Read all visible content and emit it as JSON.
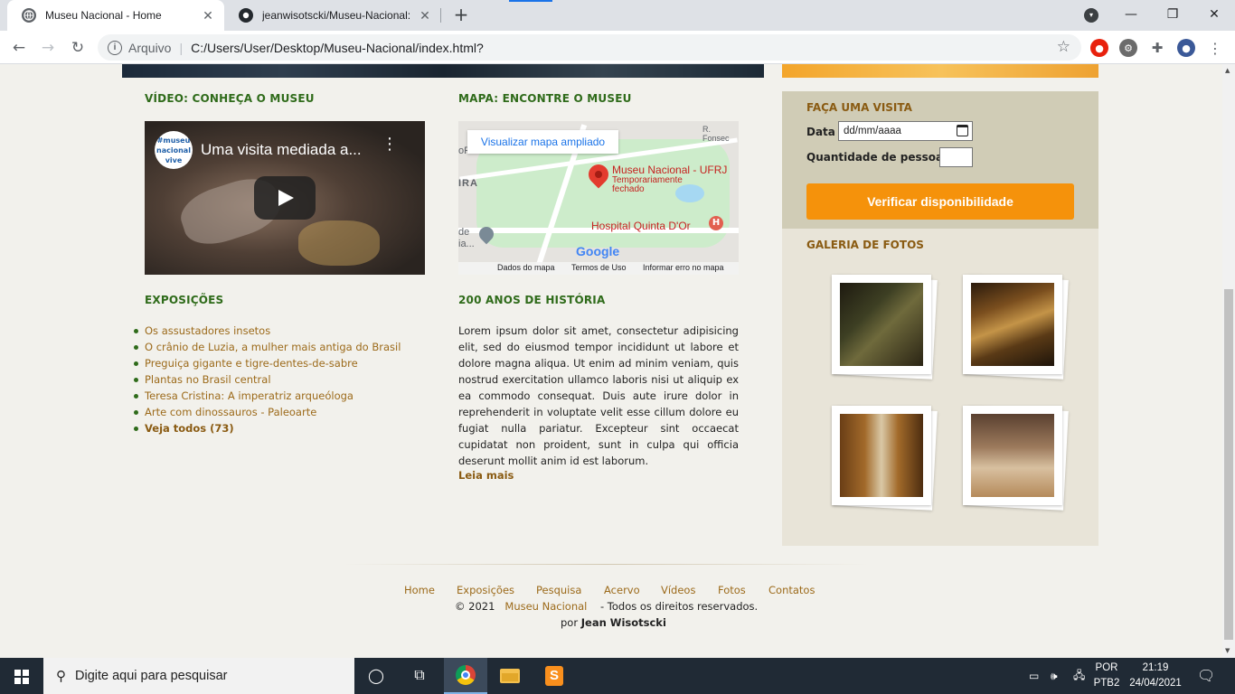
{
  "browser": {
    "tabs": [
      {
        "title": "Museu Nacional - Home",
        "active": true
      },
      {
        "title": "jeanwisotscki/Museu-Nacional: P",
        "active": false
      }
    ],
    "address": {
      "scheme_label": "Arquivo",
      "url": "C:/Users/User/Desktop/Museu-Nacional/index.html?"
    }
  },
  "sections": {
    "video_title": "VÍDEO: CONHEÇA O MUSEU",
    "map_title": "MAPA: ENCONTRE O MUSEU",
    "expos_title": "EXPOSIÇÕES",
    "history_title": "200 ANOS DE HISTÓRIA"
  },
  "video": {
    "channel_logo": "#museu nacional vive",
    "title": "Uma visita mediada a..."
  },
  "map": {
    "enlarge_button": "Visualizar mapa ampliado",
    "place_name": "Museu Nacional - UFRJ",
    "place_status": "Temporariamente fechado",
    "hospital": "Hospital Quinta D'Or",
    "hospital_icon": "H",
    "edge_label_1": "R. Fonsec",
    "edge_label_2": "IRA",
    "edge_label_3": "de",
    "edge_label_4": "ia...",
    "edge_label_5": "oF",
    "google_logo": "Google",
    "footer": [
      "Dados do mapa",
      "Termos de Uso",
      "Informar erro no mapa"
    ]
  },
  "exposicoes": {
    "items": [
      "Os assustadores insetos",
      "O crânio de Luzia, a mulher mais antiga do Brasil",
      "Preguiça gigante e tigre-dentes-de-sabre",
      "Plantas no Brasil central",
      "Teresa Cristina: A imperatriz arqueóloga",
      "Arte com dinossauros - Paleoarte"
    ],
    "see_all": "Veja todos (73)"
  },
  "historia": {
    "text": "Lorem ipsum dolor sit amet, consectetur adipisicing elit, sed do eiusmod tempor incididunt ut labore et dolore magna aliqua. Ut enim ad minim veniam, quis nostrud exercitation ullamco laboris nisi ut aliquip ex ea commodo consequat. Duis aute irure dolor in reprehenderit in voluptate velit esse cillum dolore eu fugiat nulla pariatur. Excepteur sint occaecat cupidatat non proident, sunt in culpa qui officia deserunt mollit anim id est laborum.",
    "read_more": "Leia mais"
  },
  "visita": {
    "title": "FAÇA UMA VISITA",
    "date_label": "Data",
    "date_placeholder": "dd/mm/aaaa",
    "qty_label": "Quantidade de pessoas",
    "button": "Verificar disponibilidade"
  },
  "galeria": {
    "title": "GALERIA DE FOTOS"
  },
  "footer": {
    "nav": [
      "Home",
      "Exposições",
      "Pesquisa",
      "Acervo",
      "Vídeos",
      "Fotos",
      "Contatos"
    ],
    "copyright_prefix": "© 2021",
    "brand": "Museu Nacional",
    "copyright_suffix": "- Todos os direitos reservados.",
    "by_prefix": "por",
    "author": "Jean Wisotscki"
  },
  "taskbar": {
    "search_placeholder": "Digite aqui para pesquisar",
    "lang_top": "POR",
    "lang_bottom": "PTB2",
    "time": "21:19",
    "date": "24/04/2021"
  },
  "colors": {
    "section_heading": "#2f6b1a",
    "link": "#9c6a1a",
    "visit_button": "#f5920b",
    "sidebar_bg": "#e8e4d8",
    "visit_box_bg": "#d0ccb6",
    "page_bg": "#f2f1ec"
  }
}
